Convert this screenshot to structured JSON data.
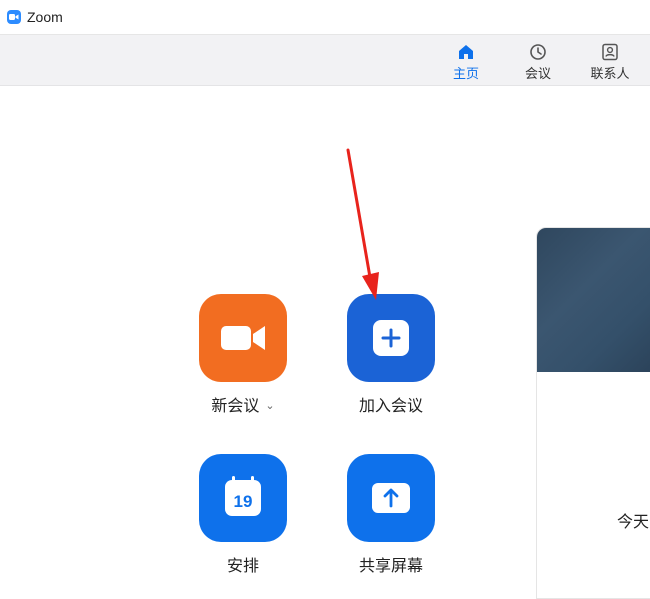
{
  "window": {
    "title": "Zoom"
  },
  "nav": {
    "tabs": [
      {
        "label": "主页",
        "icon": "home-icon",
        "active": true
      },
      {
        "label": "会议",
        "icon": "clock-icon",
        "active": false
      },
      {
        "label": "联系人",
        "icon": "contact-icon",
        "active": false
      }
    ]
  },
  "actions": {
    "new_meeting": {
      "label": "新会议",
      "icon": "video-camera-icon",
      "color": "#F26D21"
    },
    "join": {
      "label": "加入会议",
      "icon": "plus-icon",
      "color": "#1B63D6"
    },
    "schedule": {
      "label": "安排",
      "icon": "calendar-icon",
      "day": "19",
      "color": "#0E71EB"
    },
    "share_screen": {
      "label": "共享屏幕",
      "icon": "upload-arrow-icon",
      "color": "#0E71EB"
    }
  },
  "side_panel": {
    "today_label": "今天"
  },
  "colors": {
    "accent": "#0E71EB",
    "brand": "#2D8CFF",
    "annotation": "#E8231C"
  }
}
